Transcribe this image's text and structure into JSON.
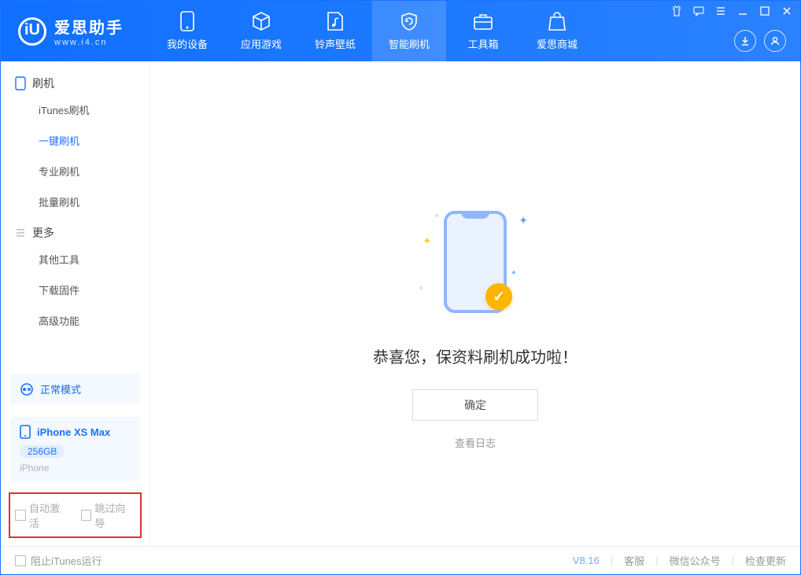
{
  "app": {
    "name_cn": "爱思助手",
    "name_en": "www.i4.cn"
  },
  "tabs": {
    "device": "我的设备",
    "apps": "应用游戏",
    "ring": "铃声壁纸",
    "flash": "智能刷机",
    "tools": "工具箱",
    "store": "爱思商城"
  },
  "sidebar": {
    "section_flash": "刷机",
    "items_flash": [
      "iTunes刷机",
      "一键刷机",
      "专业刷机",
      "批量刷机"
    ],
    "section_more": "更多",
    "items_more": [
      "其他工具",
      "下载固件",
      "高级功能"
    ]
  },
  "mode": {
    "label": "正常模式"
  },
  "device": {
    "name": "iPhone XS Max",
    "capacity": "256GB",
    "sub": "iPhone"
  },
  "options": {
    "auto_activate": "自动激活",
    "skip_guide": "跳过向导"
  },
  "main": {
    "success": "恭喜您，保资料刷机成功啦！",
    "ok": "确定",
    "view_log": "查看日志"
  },
  "status": {
    "block_itunes": "阻止iTunes运行",
    "version": "V8.16",
    "support": "客服",
    "wechat": "微信公众号",
    "update": "检查更新"
  }
}
